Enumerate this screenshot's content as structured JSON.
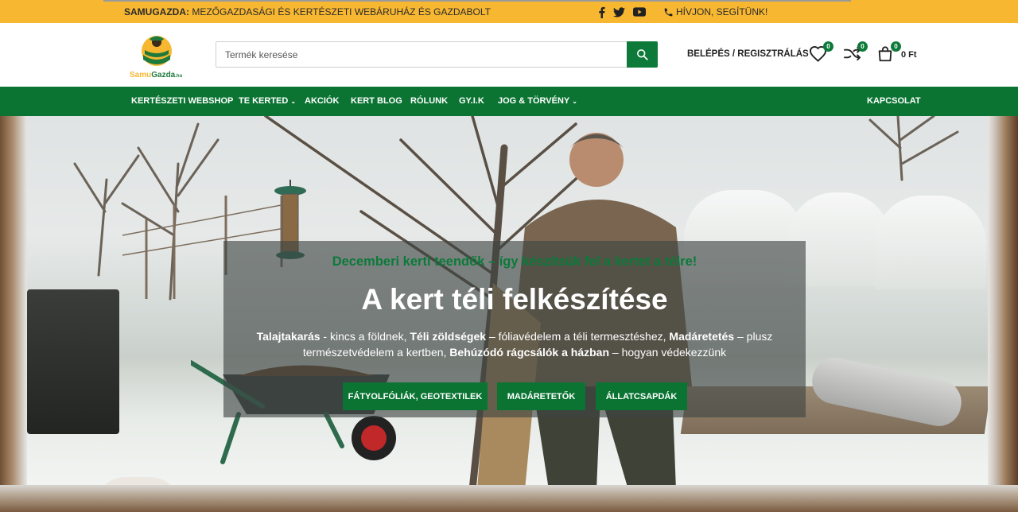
{
  "topbar": {
    "brand": "SAMUGAZDA:",
    "tagline": " MEZŐGAZDASÁGI ÉS KERTÉSZETI WEBÁRUHÁZ ÉS GAZDABOLT",
    "social": [
      "facebook-icon",
      "twitter-icon",
      "youtube-icon"
    ],
    "call_label": "HÍVJON, SEGÍTÜNK!"
  },
  "header": {
    "logo": {
      "brand_a": "Samu",
      "brand_b": "Gazda",
      "brand_c": ".hu"
    },
    "search": {
      "placeholder": "Termék keresése"
    },
    "login_label": "BELÉPÉS / REGISZTRÁLÁS",
    "wishlist_count": "0",
    "compare_count": "0",
    "cart_count": "0",
    "cart_total": "0 Ft"
  },
  "nav": {
    "items": [
      {
        "label": "KERTÉSZETI WEBSHOP",
        "dropdown": false
      },
      {
        "label": "TE KERTED",
        "dropdown": true
      },
      {
        "label": "AKCIÓK",
        "dropdown": false
      },
      {
        "label": "KERT BLOG",
        "dropdown": false
      },
      {
        "label": "RÓLUNK",
        "dropdown": false
      },
      {
        "label": "GY.I.K",
        "dropdown": false
      },
      {
        "label": "JOG & TÖRVÉNY",
        "dropdown": true
      }
    ],
    "contact_label": "KAPCSOLAT"
  },
  "hero": {
    "kicker": "Decemberi kerti teendők – így készítsük fel a kertet a télre!",
    "title": "A kert téli felkészítése",
    "desc": {
      "b1": "Talajtakarás",
      "t1": " - kincs a földnek, ",
      "b2": "Téli zöldségek",
      "t2": " – fóliavédelem a téli termesztéshez, ",
      "b3": "Madáretetés",
      "t3": " – plusz természetvédelem a kertben, ",
      "b4": "Behúzódó rágcsálók a házban",
      "t4": " – hogyan védekezzünk"
    },
    "buttons": [
      "FÁTYOLFÓLIÁK, GEOTEXTILEK",
      "MADÁRETETŐK",
      "ÁLLATCSAPDÁK"
    ]
  },
  "colors": {
    "accent_yellow": "#f7b731",
    "brand_green": "#0b7433"
  }
}
